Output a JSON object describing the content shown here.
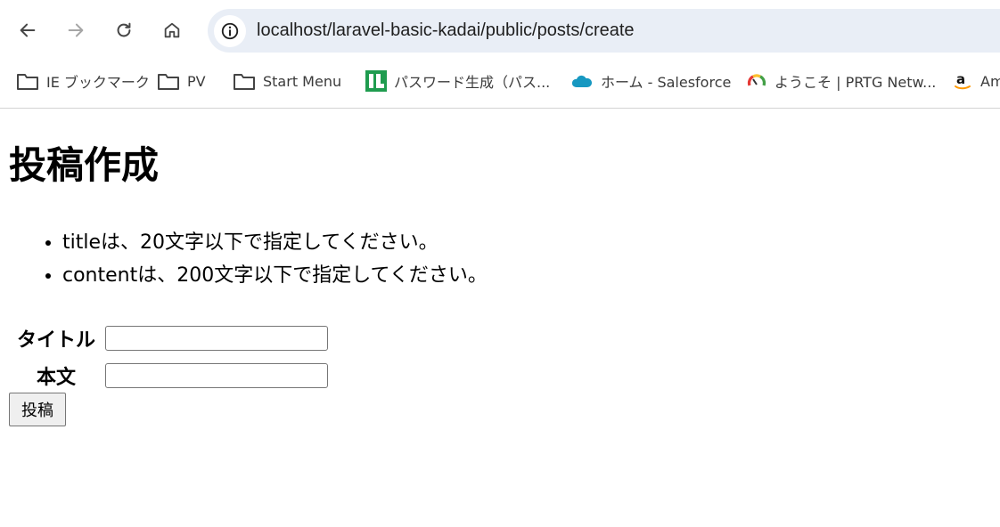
{
  "browser": {
    "url": "localhost/laravel-basic-kadai/public/posts/create",
    "bookmarks": [
      {
        "label": "IE ブックマーク",
        "icon": "folder-icon"
      },
      {
        "label": "PV",
        "icon": "folder-icon"
      },
      {
        "label": "Start Menu",
        "icon": "folder-icon"
      },
      {
        "label": "パスワード生成（パス...",
        "icon": "password-generator-icon"
      },
      {
        "label": "ホーム - Salesforce",
        "icon": "salesforce-icon"
      },
      {
        "label": "ようこそ | PRTG Netw...",
        "icon": "prtg-icon"
      },
      {
        "label": "Am",
        "icon": "amazon-icon"
      }
    ]
  },
  "page": {
    "title": "投稿作成",
    "errors": [
      "titleは、20文字以下で指定してください。",
      "contentは、200文字以下で指定してください。"
    ],
    "form": {
      "title_label": "タイトル",
      "title_value": "",
      "content_label": "本文",
      "content_value": "",
      "submit_label": "投稿"
    }
  },
  "colors": {
    "omnibox_bg": "#e9eef6",
    "password_icon_green": "#1f9c4f",
    "salesforce_blue": "#1798c1",
    "amazon_orange": "#ff9900"
  }
}
